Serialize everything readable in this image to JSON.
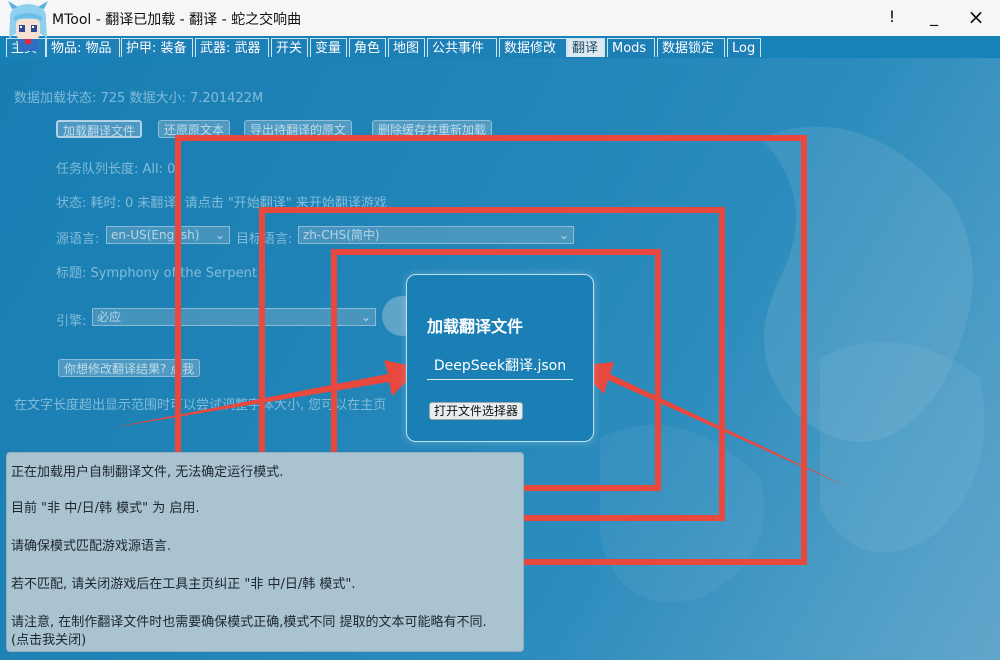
{
  "window": {
    "title": "MTool - 翻译已加载 - 翻译 - 蛇之交响曲",
    "btn_info": "!",
    "btn_min": "_",
    "btn_close": "×"
  },
  "tabs": [
    {
      "label": "主页"
    },
    {
      "label": "物品: 物品"
    },
    {
      "label": "护甲: 装备"
    },
    {
      "label": "武器: 武器"
    },
    {
      "label": "开关"
    },
    {
      "label": "变量"
    },
    {
      "label": "角色"
    },
    {
      "label": "地图"
    },
    {
      "label": "公共事件"
    },
    {
      "label": "数据修改"
    },
    {
      "label": "翻译"
    },
    {
      "label": "Mods"
    },
    {
      "label": "数据锁定"
    },
    {
      "label": "Log"
    }
  ],
  "active_tab": "翻译",
  "main": {
    "data_status": "数据加载状态: 725 数据大小: 7.201422M",
    "btn_load": "加载翻译文件",
    "btn_restore": "还原原文本",
    "btn_export": "导出待翻译的原文",
    "btn_clear": "删除缓存并重新加载",
    "queue_length": "任务队列长度: All: 0",
    "status": "状态: 耗时: 0 未翻译, 请点击 \"开始翻译\" 来开始翻译游戏",
    "source_lang_label": "源语言:",
    "source_lang_value": "en-US(English)",
    "target_lang_label": "目标语言:",
    "target_lang_value": "zh-CHS(简中)",
    "game_title": "标题: Symphony of the Serpent",
    "engine_label": "引擎:",
    "engine_value": "必应",
    "btn_modify": "你想修改翻译结果? 点我",
    "hint": "在文字长度超出显示范围时可以尝试调整字体大小, 您可以在主页"
  },
  "dialog": {
    "title": "加载翻译文件",
    "filename": "DeepSeek翻译.json",
    "btn_open": "打开文件选择器"
  },
  "notice": {
    "lines": [
      "正在加载用户自制翻译文件, 无法确定运行模式.",
      "目前 \"非 中/日/韩 模式\" 为 启用.",
      "请确保模式匹配游戏源语言.",
      "若不匹配, 请关闭游戏后在工具主页纠正 \"非 中/日/韩 模式\".",
      "请注意, 在制作翻译文件时也需要确保模式正确,模式不同 提取的文本可能略有不同.",
      "(点击我关闭)"
    ]
  },
  "colors": {
    "background": "#1582b8",
    "annotation_red": "#e8483e",
    "notice_bg": "#a9c3d1"
  }
}
